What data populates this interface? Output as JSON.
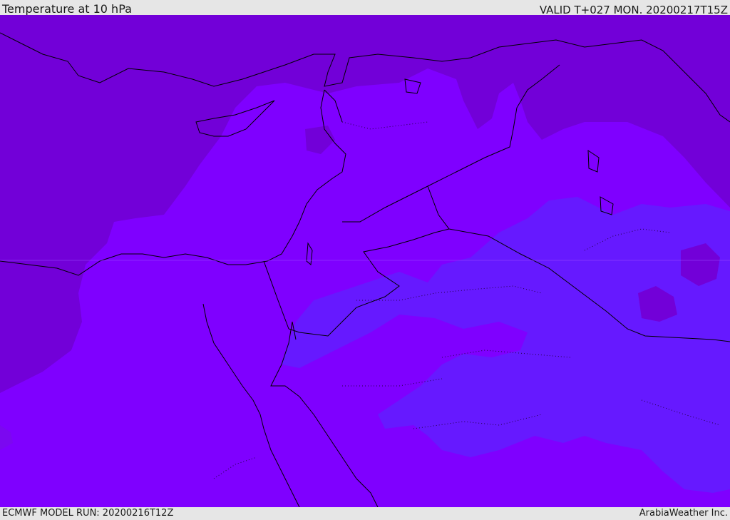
{
  "header": {
    "title": "Temperature at 10 hPa",
    "valid": "VALID T+027 MON. 20200217T15Z"
  },
  "footer": {
    "model_run": "ECMWF MODEL RUN: 20200216T12Z",
    "credit": "ArabiaWeather Inc."
  },
  "map": {
    "region": "Eastern Mediterranean / Middle East",
    "field": "temperature",
    "level": "10 hPa",
    "colors": {
      "warm_region": "#7200d8",
      "mid_region": "#7f00ff",
      "cool_region": "#6619ff",
      "coastline": "#000000"
    }
  }
}
